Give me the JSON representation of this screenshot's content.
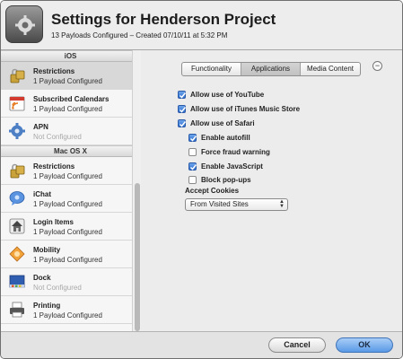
{
  "header": {
    "title": "Settings for Henderson Project",
    "subtitle": "13 Payloads Configured – Created 07/10/11 at 5:32 PM",
    "app_icon": "configurator-gear-icon"
  },
  "sidebar": {
    "sections": [
      {
        "title": "iOS",
        "items": [
          {
            "name": "Restrictions",
            "status": "1 Payload Configured",
            "icon": "lock-icon",
            "selected": true
          },
          {
            "name": "Subscribed Calendars",
            "status": "1 Payload Configured",
            "icon": "calendar-icon"
          },
          {
            "name": "APN",
            "status": "Not Configured",
            "icon": "gear-icon"
          }
        ]
      },
      {
        "title": "Mac OS X",
        "items": [
          {
            "name": "Restrictions",
            "status": "1 Payload Configured",
            "icon": "lock-icon"
          },
          {
            "name": "iChat",
            "status": "1 Payload Configured",
            "icon": "chat-icon"
          },
          {
            "name": "Login Items",
            "status": "1 Payload Configured",
            "icon": "house-icon"
          },
          {
            "name": "Mobility",
            "status": "1 Payload Configured",
            "icon": "mobility-icon"
          },
          {
            "name": "Dock",
            "status": "Not Configured",
            "icon": "dock-icon"
          },
          {
            "name": "Printing",
            "status": "1 Payload Configured",
            "icon": "printer-icon"
          }
        ]
      }
    ]
  },
  "tabs": [
    {
      "label": "Functionality",
      "active": false
    },
    {
      "label": "Applications",
      "active": true
    },
    {
      "label": "Media Content",
      "active": false
    }
  ],
  "collapse_label": "−",
  "options": [
    {
      "label": "Allow use of YouTube",
      "checked": true
    },
    {
      "label": "Allow use of iTunes Music Store",
      "checked": true
    },
    {
      "label": "Allow use of Safari",
      "checked": true
    },
    {
      "label": "Enable autofill",
      "checked": true
    },
    {
      "label": "Force fraud warning",
      "checked": false
    },
    {
      "label": "Enable JavaScript",
      "checked": true
    },
    {
      "label": "Block pop-ups",
      "checked": false
    }
  ],
  "cookies": {
    "label": "Accept Cookies",
    "value": "From Visited Sites"
  },
  "footer": {
    "cancel_label": "Cancel",
    "ok_label": "OK"
  }
}
